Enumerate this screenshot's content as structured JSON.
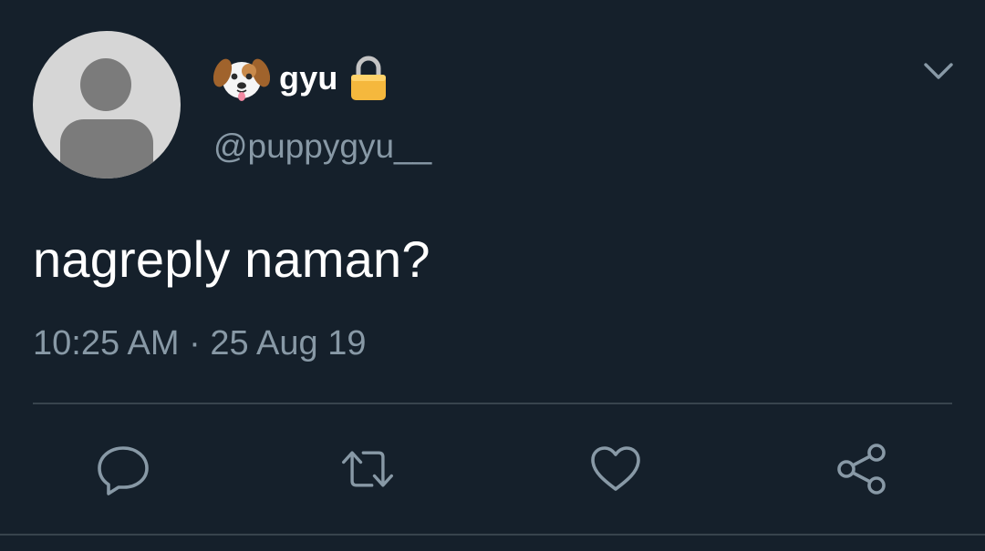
{
  "tweet": {
    "author": {
      "display_name": "gyu",
      "handle": "@puppygyu__",
      "name_prefix_icon": "dog-face-emoji",
      "name_suffix_icon": "lock-emoji",
      "avatar": "default-avatar"
    },
    "text": "nagreply naman?",
    "timestamp": "10:25 AM · 25 Aug 19",
    "menu_icon": "chevron-down-icon",
    "actions": [
      {
        "name": "reply",
        "icon": "reply-icon"
      },
      {
        "name": "retweet",
        "icon": "retweet-icon"
      },
      {
        "name": "like",
        "icon": "heart-icon"
      },
      {
        "name": "share",
        "icon": "share-icon"
      }
    ]
  },
  "colors": {
    "background": "#15202b",
    "primary_text": "#ffffff",
    "secondary_text": "#8899a6",
    "divider": "#38444d"
  }
}
